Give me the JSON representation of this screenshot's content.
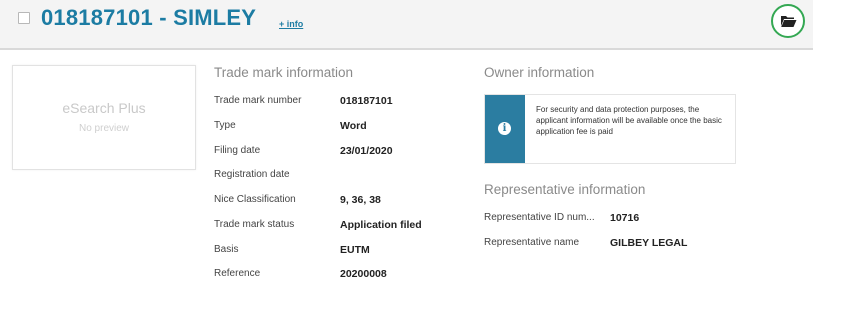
{
  "header": {
    "title": "018187101 - SIMLEY",
    "info_link": "+ info",
    "folder_icon": "folder-open-icon",
    "folder_ring_color": "#34a853"
  },
  "preview": {
    "brand": "eSearch Plus",
    "subtitle": "No preview"
  },
  "trademark": {
    "section_title": "Trade mark information",
    "rows": [
      {
        "label": "Trade mark number",
        "value": "018187101"
      },
      {
        "label": "Type",
        "value": "Word"
      },
      {
        "label": "Filing date",
        "value": "23/01/2020"
      },
      {
        "label": "Registration date",
        "value": ""
      },
      {
        "label": "Nice Classification",
        "value": "9, 36, 38"
      },
      {
        "label": "Trade mark status",
        "value": "Application filed"
      },
      {
        "label": "Basis",
        "value": "EUTM"
      },
      {
        "label": "Reference",
        "value": "20200008"
      }
    ]
  },
  "owner": {
    "section_title": "Owner information",
    "notice_icon": "info-icon",
    "notice_text": "For security and data protection purposes, the applicant information will be available once the basic application fee is paid"
  },
  "representative": {
    "section_title": "Representative information",
    "rows": [
      {
        "label": "Representative ID num...",
        "value": "10716"
      },
      {
        "label": "Representative name",
        "value": "GILBEY LEGAL"
      }
    ]
  },
  "colors": {
    "title_blue": "#1c7ca3",
    "notice_blue": "#2b7da1"
  }
}
